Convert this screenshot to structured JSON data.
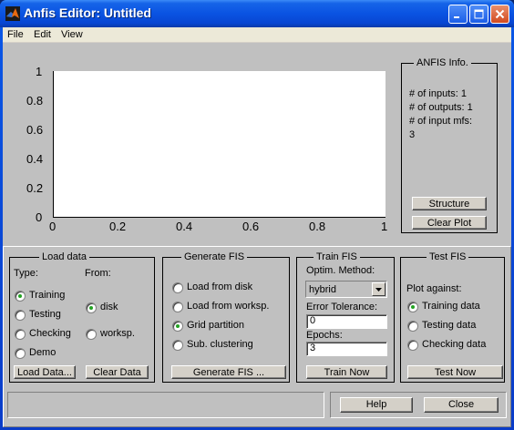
{
  "window": {
    "title": "Anfis Editor: Untitled"
  },
  "menu": [
    "File",
    "Edit",
    "View"
  ],
  "plot": {
    "y_ticks": [
      "1",
      "0.8",
      "0.6",
      "0.4",
      "0.2",
      "0"
    ],
    "x_ticks": [
      "0",
      "0.2",
      "0.4",
      "0.6",
      "0.8",
      "1"
    ]
  },
  "anfis_info": {
    "title": "ANFIS Info.",
    "lines": [
      "# of inputs: 1",
      "# of outputs: 1",
      "# of input mfs:",
      "3"
    ],
    "structure_button": "Structure",
    "clear_plot_button": "Clear Plot"
  },
  "load_data": {
    "title": "Load data",
    "type_label": "Type:",
    "from_label": "From:",
    "types": [
      "Training",
      "Testing",
      "Checking",
      "Demo"
    ],
    "selected_type": "Training",
    "sources": [
      "disk",
      "worksp."
    ],
    "selected_source": "disk",
    "load_button": "Load Data...",
    "clear_button": "Clear Data"
  },
  "generate_fis": {
    "title": "Generate FIS",
    "options": [
      "Load from disk",
      "Load from worksp.",
      "Grid partition",
      "Sub. clustering"
    ],
    "selected": "Grid partition",
    "button": "Generate FIS ..."
  },
  "train_fis": {
    "title": "Train FIS",
    "method_label": "Optim. Method:",
    "method_value": "hybrid",
    "tolerance_label": "Error Tolerance:",
    "tolerance_value": "0",
    "epochs_label": "Epochs:",
    "epochs_value": "3",
    "button": "Train Now"
  },
  "test_fis": {
    "title": "Test FIS",
    "plot_against_label": "Plot against:",
    "options": [
      "Training data",
      "Testing data",
      "Checking data"
    ],
    "selected": "Training data",
    "button": "Test Now"
  },
  "status": {
    "text": ""
  },
  "footer": {
    "help_button": "Help",
    "close_button": "Close"
  },
  "colors": {
    "radio_selected": "#24a324",
    "titlebar": "#0a53e2",
    "background": "#c0c0c0"
  }
}
